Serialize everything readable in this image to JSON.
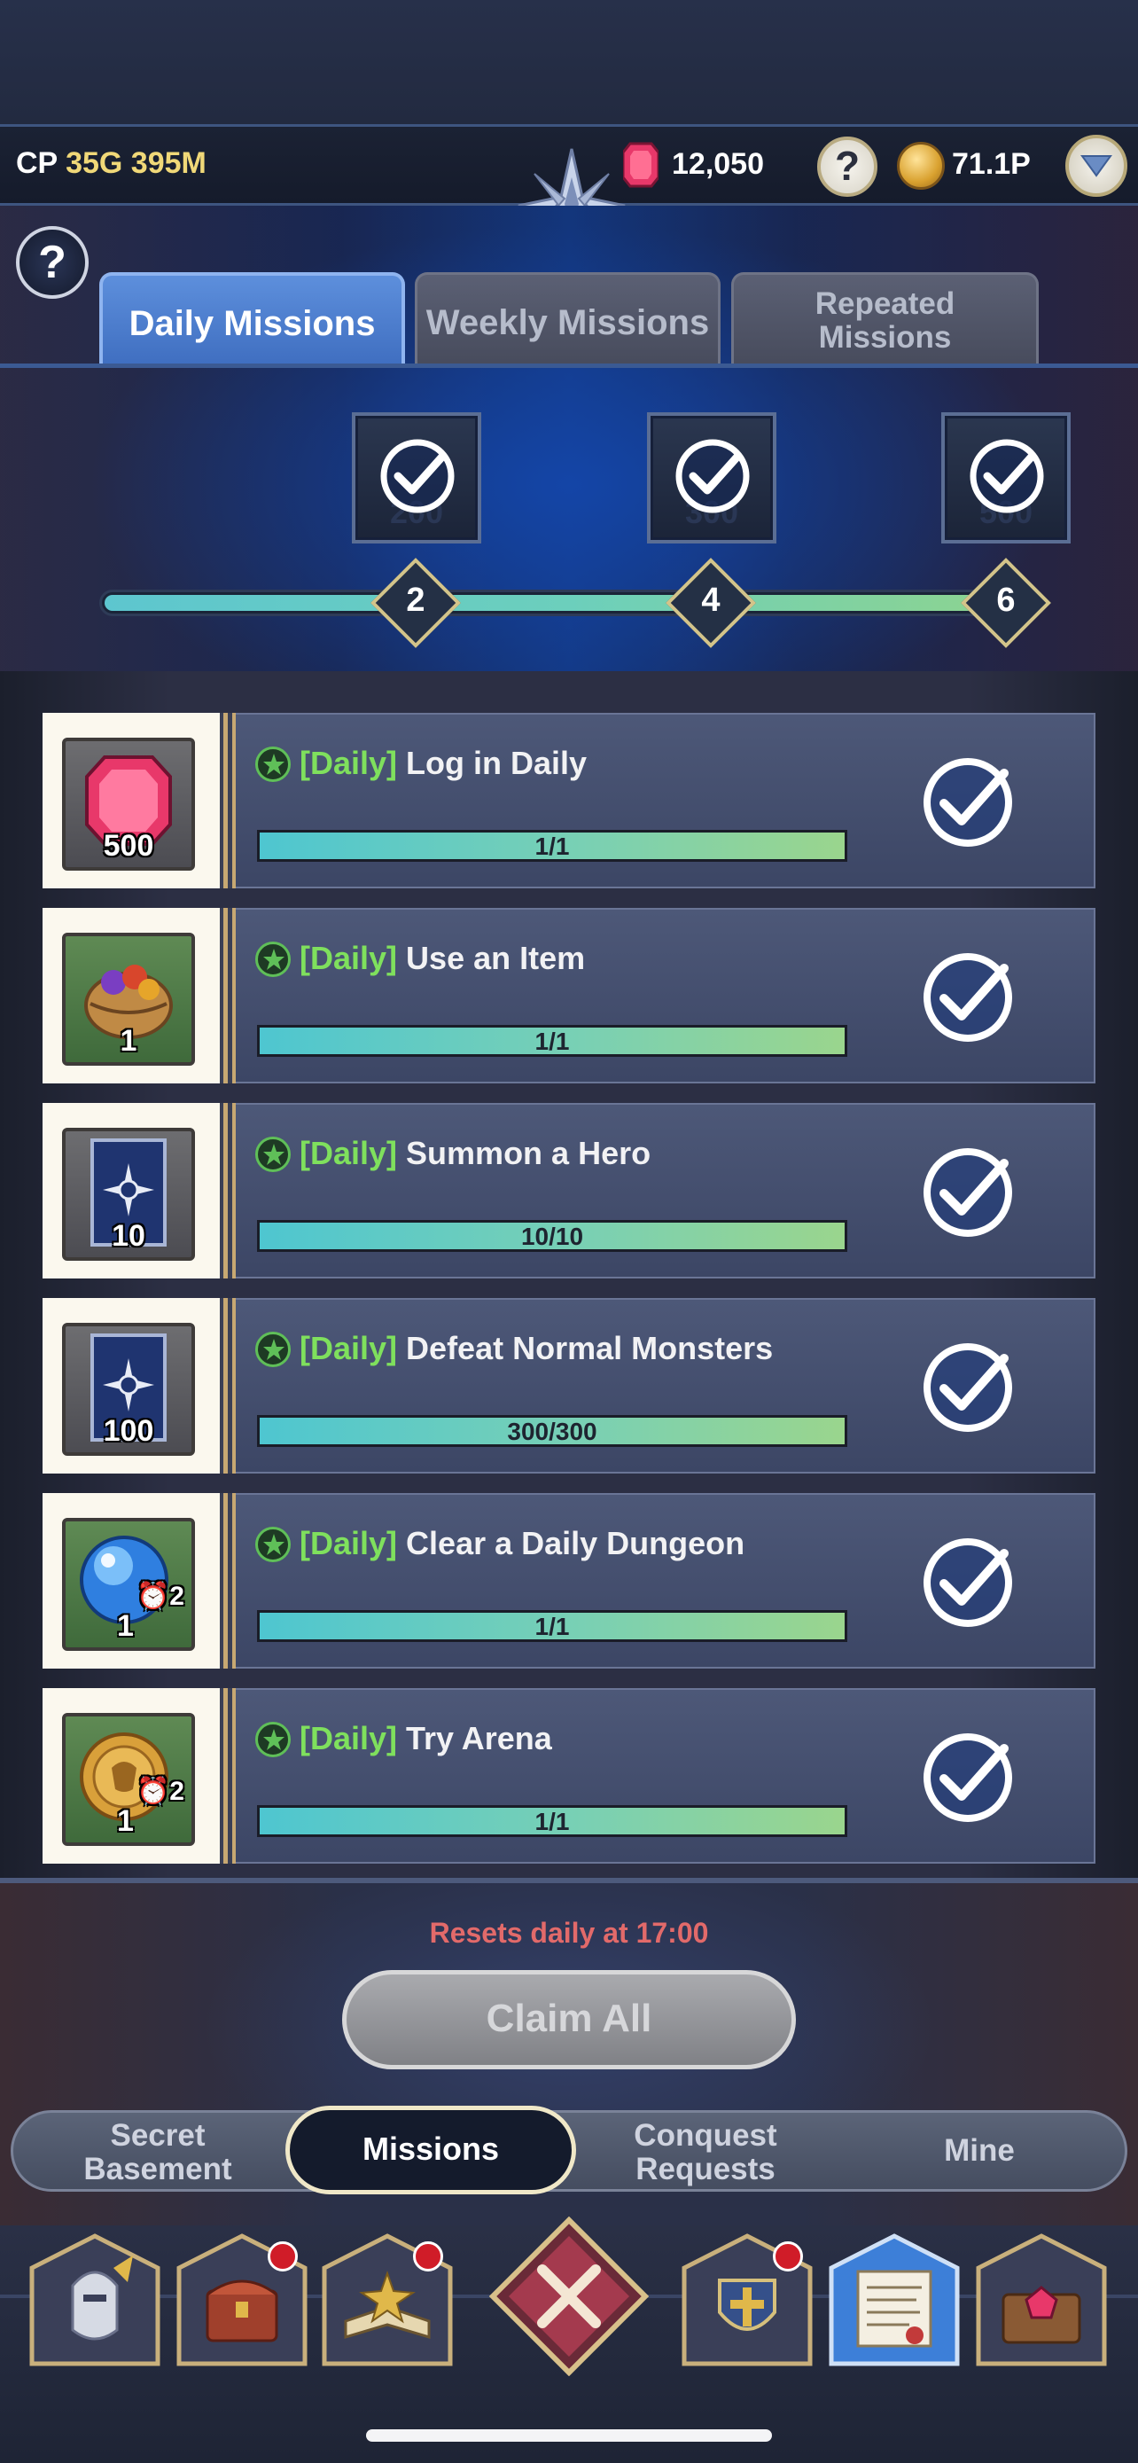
{
  "header": {
    "cp_label": "CP",
    "cp_value": "35G 395M",
    "gems": "12,050",
    "gold": "71.1P",
    "help_glyph": "?"
  },
  "tabs": [
    {
      "label": "Daily Missions",
      "active": true
    },
    {
      "label": "Weekly Missions",
      "active": false
    },
    {
      "label": "Repeated Missions",
      "active": false
    }
  ],
  "reward_track": {
    "rewards": [
      {
        "points": "200",
        "claimed": true
      },
      {
        "points": "300",
        "claimed": true
      },
      {
        "points": "500",
        "claimed": true
      }
    ],
    "milestones": [
      "2",
      "4",
      "6"
    ],
    "progress": 1.0
  },
  "missions": [
    {
      "tag": "[Daily]",
      "title": "Log in Daily",
      "progress": "1/1",
      "reward_qty": "500",
      "reward_icon": "gem-icon",
      "done": true
    },
    {
      "tag": "[Daily]",
      "title": "Use an Item",
      "progress": "1/1",
      "reward_qty": "1",
      "reward_icon": "basket-icon",
      "done": true
    },
    {
      "tag": "[Daily]",
      "title": "Summon a Hero",
      "progress": "10/10",
      "reward_qty": "10",
      "reward_icon": "summon-card-icon",
      "done": true
    },
    {
      "tag": "[Daily]",
      "title": "Defeat Normal Monsters",
      "progress": "300/300",
      "reward_qty": "100",
      "reward_icon": "summon-card-icon",
      "done": true
    },
    {
      "tag": "[Daily]",
      "title": "Clear a Daily Dungeon",
      "progress": "1/1",
      "reward_qty": "1",
      "reward_timer": "⏰2",
      "reward_icon": "blue-orb-icon",
      "done": true
    },
    {
      "tag": "[Daily]",
      "title": "Try Arena",
      "progress": "1/1",
      "reward_qty": "1",
      "reward_timer": "⏰2",
      "reward_icon": "arena-coin-icon",
      "done": true
    }
  ],
  "footer": {
    "reset_text": "Resets daily at 17:00",
    "claim_all": "Claim All"
  },
  "nav": {
    "secret_basement": "Secret Basement",
    "missions": "Missions",
    "conquest_requests": "Conquest Requests",
    "mine": "Mine"
  },
  "dock": [
    {
      "icon": "knight-helmet-icon",
      "badge": false
    },
    {
      "icon": "treasure-chest-icon",
      "badge": true
    },
    {
      "icon": "spellbook-icon",
      "badge": true
    },
    {
      "icon": "close-icon",
      "badge": false
    },
    {
      "icon": "guild-shield-icon",
      "badge": true
    },
    {
      "icon": "scroll-letter-icon",
      "badge": false
    },
    {
      "icon": "gem-chest-icon",
      "badge": false
    }
  ],
  "colors": {
    "accent_blue": "#4f83d6",
    "daily_tag": "#7fe05d",
    "reset_red": "#e26a6a",
    "progress_start": "#4ec6d0",
    "progress_end": "#9ad58d"
  }
}
